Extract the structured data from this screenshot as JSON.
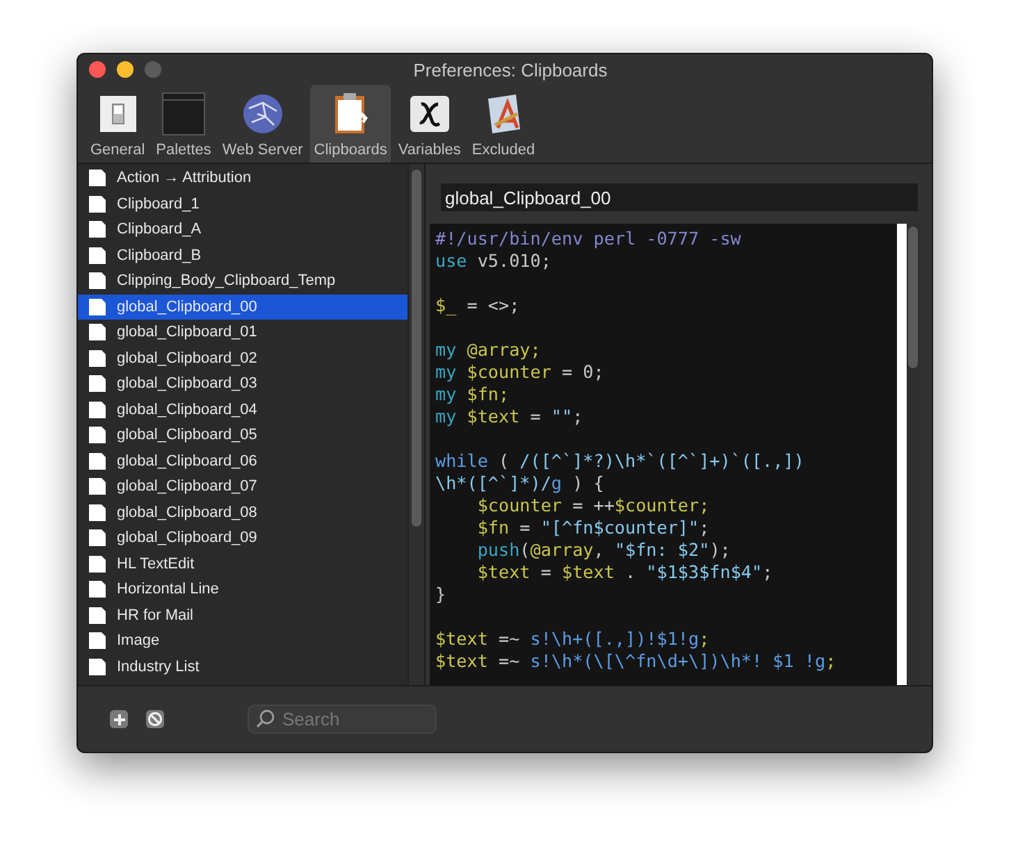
{
  "window": {
    "title": "Preferences: Clipboards"
  },
  "toolbar": [
    {
      "label": "General",
      "kind": "general",
      "selected": false
    },
    {
      "label": "Palettes",
      "kind": "palettes",
      "selected": false
    },
    {
      "label": "Web Server",
      "kind": "web",
      "selected": false
    },
    {
      "label": "Clipboards",
      "kind": "clipboards",
      "selected": true
    },
    {
      "label": "Variables",
      "kind": "variables",
      "selected": false
    },
    {
      "label": "Excluded",
      "kind": "excluded",
      "selected": false
    }
  ],
  "sidebar": {
    "items": [
      {
        "label": "Action → Attribution",
        "selected": false
      },
      {
        "label": "Clipboard_1",
        "selected": false
      },
      {
        "label": "Clipboard_A",
        "selected": false
      },
      {
        "label": "Clipboard_B",
        "selected": false
      },
      {
        "label": "Clipping_Body_Clipboard_Temp",
        "selected": false
      },
      {
        "label": "global_Clipboard_00",
        "selected": true
      },
      {
        "label": "global_Clipboard_01",
        "selected": false
      },
      {
        "label": "global_Clipboard_02",
        "selected": false
      },
      {
        "label": "global_Clipboard_03",
        "selected": false
      },
      {
        "label": "global_Clipboard_04",
        "selected": false
      },
      {
        "label": "global_Clipboard_05",
        "selected": false
      },
      {
        "label": "global_Clipboard_06",
        "selected": false
      },
      {
        "label": "global_Clipboard_07",
        "selected": false
      },
      {
        "label": "global_Clipboard_08",
        "selected": false
      },
      {
        "label": "global_Clipboard_09",
        "selected": false
      },
      {
        "label": "HL TextEdit",
        "selected": false
      },
      {
        "label": "Horizontal Line",
        "selected": false
      },
      {
        "label": "HR for Mail",
        "selected": false
      },
      {
        "label": "Image",
        "selected": false
      },
      {
        "label": "Industry List",
        "selected": false
      }
    ]
  },
  "editor": {
    "name": "global_Clipboard_00",
    "lines": [
      {
        "gap_before": false,
        "indented": false,
        "segments": [
          {
            "kind": "comment",
            "text": "#!/usr/bin/env perl -0777 -sw"
          }
        ]
      },
      {
        "gap_before": false,
        "indented": false,
        "segments": [
          {
            "kind": "keyword",
            "text": "use"
          },
          {
            "kind": "plain",
            "text": " v5.010;"
          }
        ]
      },
      {
        "gap_before": true,
        "indented": false,
        "segments": [
          {
            "kind": "variable",
            "text": "$_"
          },
          {
            "kind": "plain",
            "text": " = <>;"
          }
        ]
      },
      {
        "gap_before": true,
        "indented": false,
        "segments": [
          {
            "kind": "keyword",
            "text": "my"
          },
          {
            "kind": "variable",
            "text": " @array;"
          }
        ]
      },
      {
        "gap_before": false,
        "indented": false,
        "segments": [
          {
            "kind": "keyword",
            "text": "my"
          },
          {
            "kind": "variable",
            "text": " $counter"
          },
          {
            "kind": "plain",
            "text": " = 0;"
          }
        ]
      },
      {
        "gap_before": false,
        "indented": false,
        "segments": [
          {
            "kind": "keyword",
            "text": "my"
          },
          {
            "kind": "variable",
            "text": " $fn;"
          }
        ]
      },
      {
        "gap_before": false,
        "indented": false,
        "segments": [
          {
            "kind": "keyword",
            "text": "my"
          },
          {
            "kind": "variable",
            "text": " $text"
          },
          {
            "kind": "plain",
            "text": " = "
          },
          {
            "kind": "string",
            "text": "\"\""
          },
          {
            "kind": "plain",
            "text": ";"
          }
        ]
      },
      {
        "gap_before": true,
        "indented": false,
        "segments": [
          {
            "kind": "control",
            "text": "while"
          },
          {
            "kind": "plain",
            "text": " ( "
          },
          {
            "kind": "string",
            "text": "/([^`]*?)\\h*`([^`]+)`([.,])"
          }
        ]
      },
      {
        "gap_before": false,
        "indented": false,
        "segments": [
          {
            "kind": "string",
            "text": "\\h*([^`]*)/"
          },
          {
            "kind": "control",
            "text": "g"
          },
          {
            "kind": "plain",
            "text": " ) {"
          }
        ]
      },
      {
        "gap_before": false,
        "indented": true,
        "segments": [
          {
            "kind": "variable",
            "text": "$counter"
          },
          {
            "kind": "plain",
            "text": " = ++"
          },
          {
            "kind": "variable",
            "text": "$counter;"
          }
        ]
      },
      {
        "gap_before": false,
        "indented": true,
        "segments": [
          {
            "kind": "variable",
            "text": "$fn"
          },
          {
            "kind": "plain",
            "text": " = "
          },
          {
            "kind": "string",
            "text": "\"[^fn$counter]\""
          },
          {
            "kind": "plain",
            "text": ";"
          }
        ]
      },
      {
        "gap_before": false,
        "indented": true,
        "segments": [
          {
            "kind": "keyword",
            "text": "push"
          },
          {
            "kind": "plain",
            "text": "("
          },
          {
            "kind": "variable",
            "text": "@array"
          },
          {
            "kind": "plain",
            "text": ", "
          },
          {
            "kind": "string",
            "text": "\"$fn: $2\""
          },
          {
            "kind": "plain",
            "text": ");"
          }
        ]
      },
      {
        "gap_before": false,
        "indented": true,
        "segments": [
          {
            "kind": "variable",
            "text": "$text"
          },
          {
            "kind": "plain",
            "text": " = "
          },
          {
            "kind": "variable",
            "text": "$text"
          },
          {
            "kind": "plain",
            "text": " . "
          },
          {
            "kind": "string",
            "text": "\"$1$3$fn$4\""
          },
          {
            "kind": "plain",
            "text": ";"
          }
        ]
      },
      {
        "gap_before": false,
        "indented": false,
        "segments": [
          {
            "kind": "plain",
            "text": "}"
          }
        ]
      },
      {
        "gap_before": true,
        "indented": false,
        "segments": [
          {
            "kind": "variable",
            "text": "$text"
          },
          {
            "kind": "plain",
            "text": " =~ "
          },
          {
            "kind": "control",
            "text": "s!\\h+([.,])!$1!g"
          },
          {
            "kind": "variable",
            "text": ";"
          }
        ]
      },
      {
        "gap_before": false,
        "indented": false,
        "segments": [
          {
            "kind": "variable",
            "text": "$text"
          },
          {
            "kind": "plain",
            "text": " =~ "
          },
          {
            "kind": "control",
            "text": "s!\\h*(\\[\\^fn\\d+\\])\\h*! $1 !g"
          },
          {
            "kind": "variable",
            "text": ";"
          }
        ]
      }
    ]
  },
  "bottom_bar": {
    "search": {
      "placeholder": "Search"
    }
  }
}
